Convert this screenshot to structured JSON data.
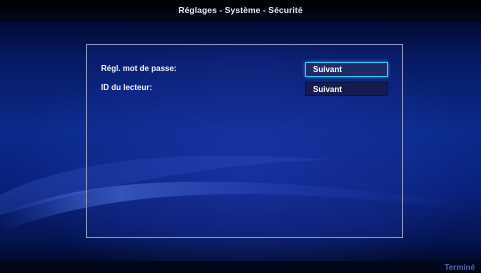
{
  "header": {
    "title": "Réglages - Système - Sécurité"
  },
  "settings": {
    "rows": [
      {
        "label": "Régl. mot de passe:",
        "button": "Suivant"
      },
      {
        "label": "ID du lecteur:",
        "button": "Suivant"
      }
    ]
  },
  "footer": {
    "done_label": "Terminé"
  },
  "colors": {
    "focus_border": "#38c9f0",
    "panel_border": "#8c98bf",
    "background": "#0a2a8a"
  }
}
